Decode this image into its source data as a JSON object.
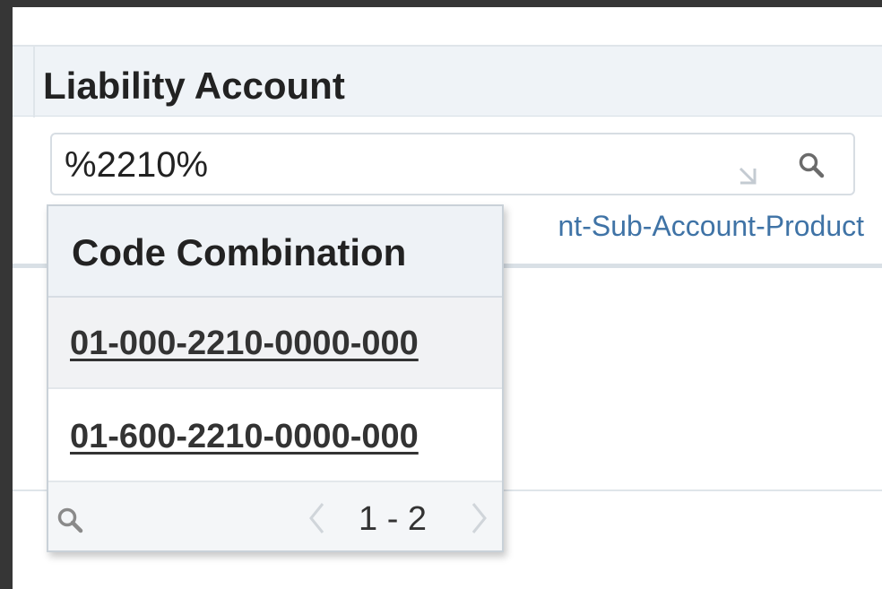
{
  "header": {
    "title": "Liability Account"
  },
  "input": {
    "value": "%2210%"
  },
  "hint": {
    "text": "nt-Sub-Account-Product"
  },
  "dropdown": {
    "column_header": "Code Combination",
    "rows": [
      {
        "code": "01-000-2210-0000-000"
      },
      {
        "code": "01-600-2210-0000-000"
      }
    ],
    "pager": {
      "range": "1 - 2"
    }
  },
  "icons": {
    "input_expand": "expand-arrow-icon",
    "input_search": "search-icon",
    "footer_search": "search-icon",
    "prev": "chevron-left-icon",
    "next": "chevron-right-icon"
  },
  "colors": {
    "frame": "#363636",
    "header_bg": "#eff3f7",
    "link_hint": "#3f73a6",
    "text": "#222222"
  }
}
